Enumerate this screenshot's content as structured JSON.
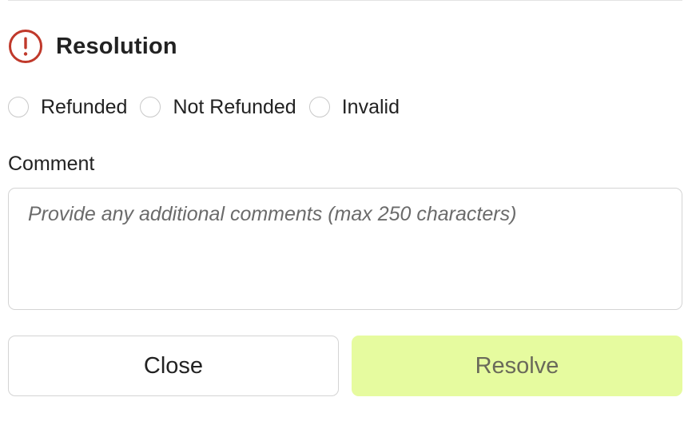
{
  "header": {
    "title": "Resolution",
    "icon": "alert-circle-icon",
    "icon_color": "#c0392b"
  },
  "resolution_options": [
    {
      "label": "Refunded",
      "selected": false
    },
    {
      "label": "Not Refunded",
      "selected": false
    },
    {
      "label": "Invalid",
      "selected": false
    }
  ],
  "comment": {
    "label": "Comment",
    "placeholder": "Provide any additional comments (max 250 characters)",
    "value": ""
  },
  "actions": {
    "close_label": "Close",
    "resolve_label": "Resolve",
    "resolve_color": "#e6fb9f"
  }
}
